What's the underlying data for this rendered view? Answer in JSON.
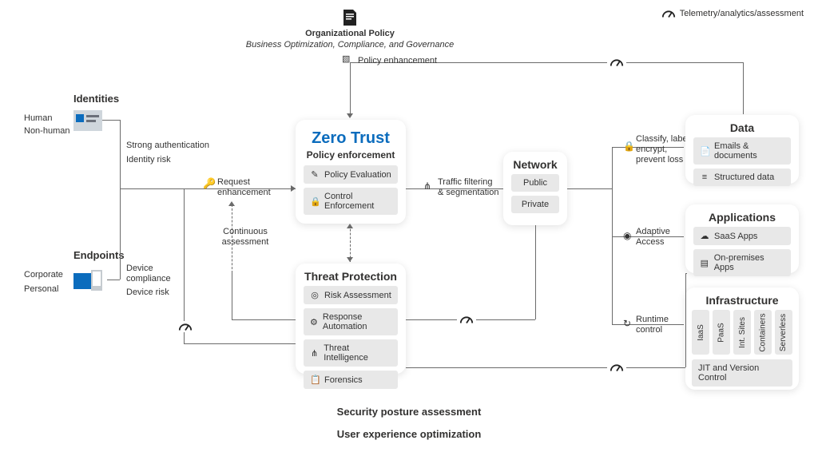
{
  "legend": {
    "telemetry": "Telemetry/analytics/assessment"
  },
  "org": {
    "title": "Organizational Policy",
    "subtitle": "Business Optimization, Compliance, and Governance",
    "policy_enhancement": "Policy enhancement"
  },
  "identities": {
    "title": "Identities",
    "items": [
      "Human",
      "Non-human"
    ],
    "strong_auth": "Strong authentication",
    "identity_risk": "Identity risk"
  },
  "endpoints": {
    "title": "Endpoints",
    "items": [
      "Corporate",
      "Personal"
    ],
    "device_compliance": "Device compliance",
    "device_risk": "Device risk"
  },
  "request_enh": "Request enhancement",
  "continuous": "Continuous assessment",
  "zero_trust": {
    "title": "Zero Trust",
    "subtitle": "Policy enforcement",
    "eval": "Policy Evaluation",
    "enforce": "Control Enforcement"
  },
  "threat": {
    "title": "Threat Protection",
    "risk": "Risk Assessment",
    "resp": "Response Automation",
    "intel": "Threat Intelligence",
    "foren": "Forensics"
  },
  "traffic": {
    "l1": "Traffic filtering",
    "l2": "& segmentation"
  },
  "network": {
    "title": "Network",
    "public": "Public",
    "private": "Private"
  },
  "data": {
    "title": "Data",
    "emails": "Emails & documents",
    "structured": "Structured data",
    "classify_l1": "Classify, label,",
    "classify_l2": "encrypt,",
    "classify_l3": "prevent loss"
  },
  "apps": {
    "title": "Applications",
    "saas": "SaaS Apps",
    "onprem": "On-premises Apps",
    "adaptive_l1": "Adaptive",
    "adaptive_l2": "Access"
  },
  "infra": {
    "title": "Infrastructure",
    "iaas": "IaaS",
    "paas": "PaaS",
    "intsites": "Int. Sites",
    "containers": "Containers",
    "serverless": "Serverless",
    "jit": "JIT and Version Control",
    "runtime_l1": "Runtime",
    "runtime_l2": "control"
  },
  "rules": {
    "posture": "Security posture assessment",
    "ux": "User experience optimization"
  }
}
